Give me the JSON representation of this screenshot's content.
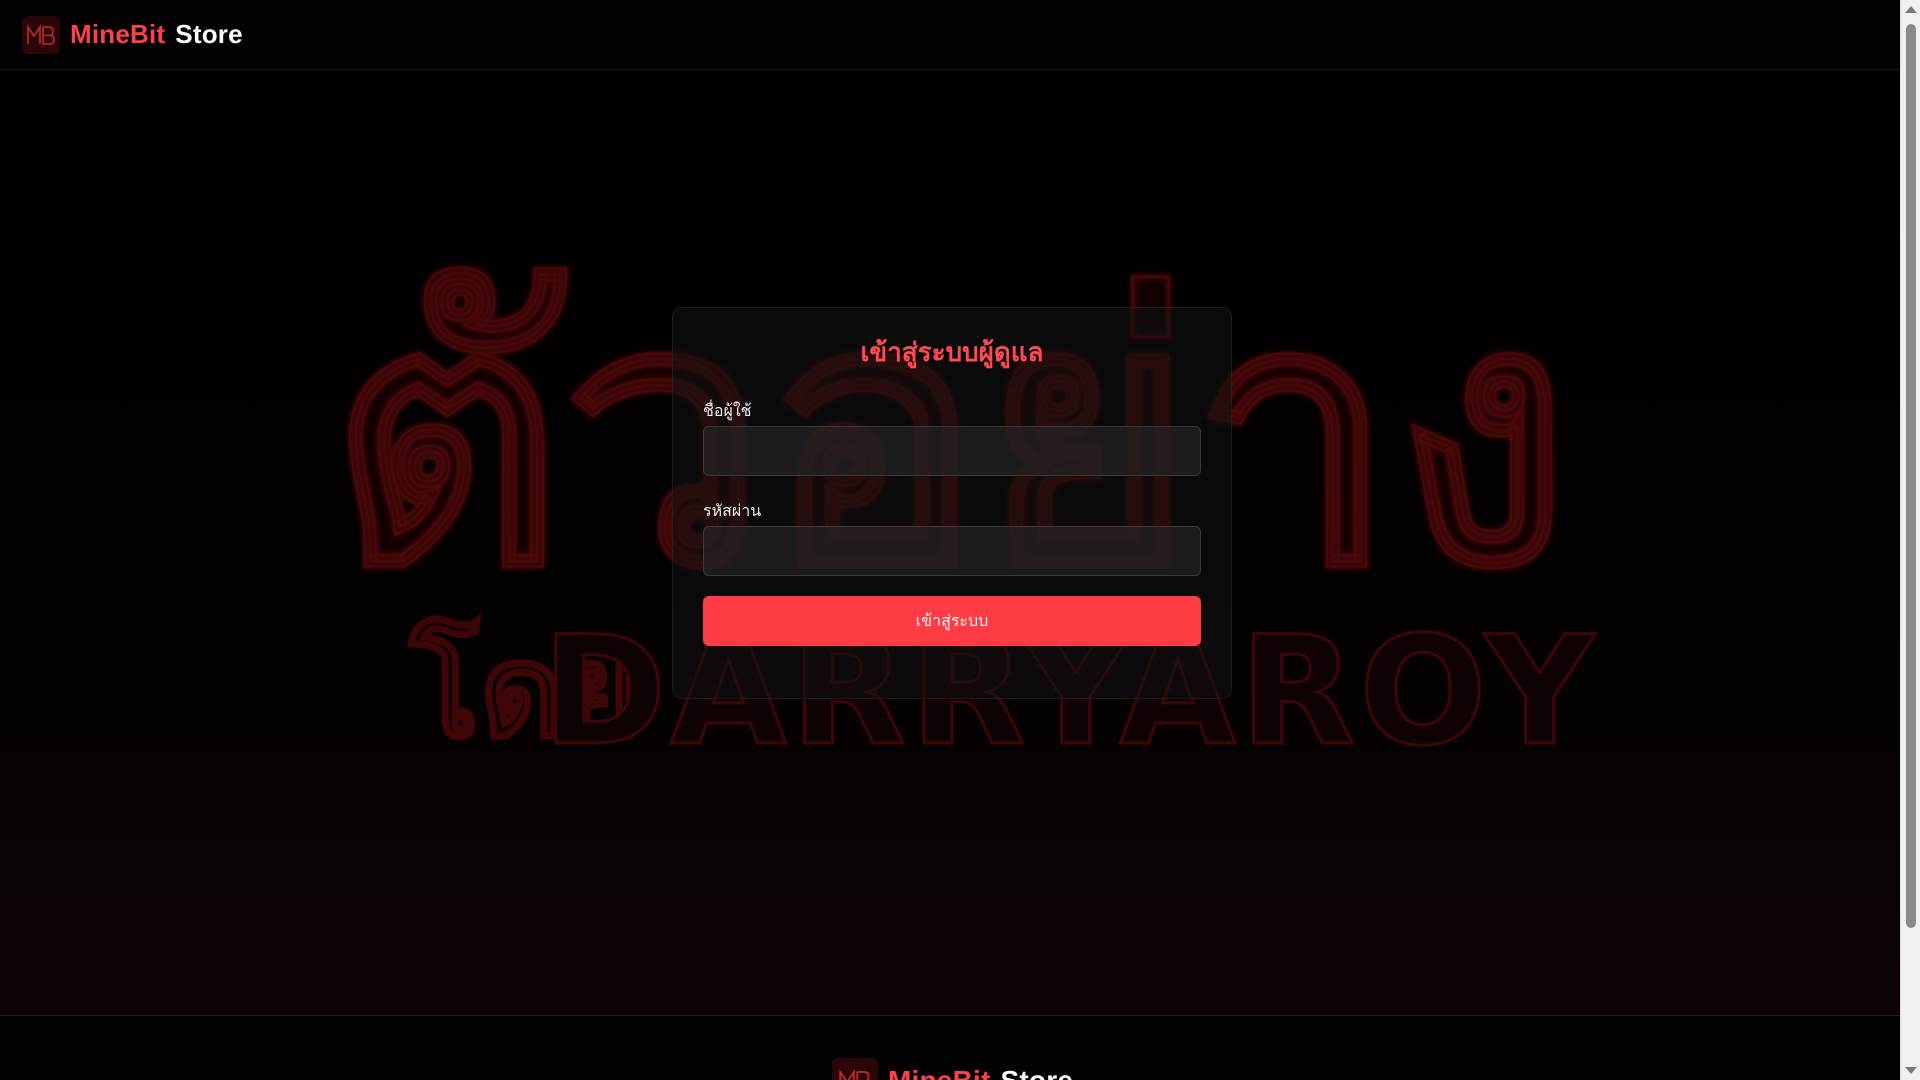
{
  "header": {
    "logo_icon": "mb-logo-icon",
    "brand_accent": "MineBit",
    "brand_plain": "Store"
  },
  "watermark": {
    "line1": "ตัวอย่าง",
    "line2_prefix": "โดย",
    "line2_name": "DARRYAROY"
  },
  "login": {
    "title": "เข้าสู่ระบบผู้ดูแล",
    "username_label": "ชื่อผู้ใช้",
    "username_value": "",
    "password_label": "รหัสผ่าน",
    "password_value": "",
    "submit_label": "เข้าสู่ระบบ"
  },
  "footer": {
    "logo_icon": "mb-logo-icon",
    "brand_accent": "MineBit",
    "brand_plain": "Store"
  },
  "colors": {
    "accent": "#ff3b43",
    "background": "#000000",
    "title": "#ff4a52"
  }
}
